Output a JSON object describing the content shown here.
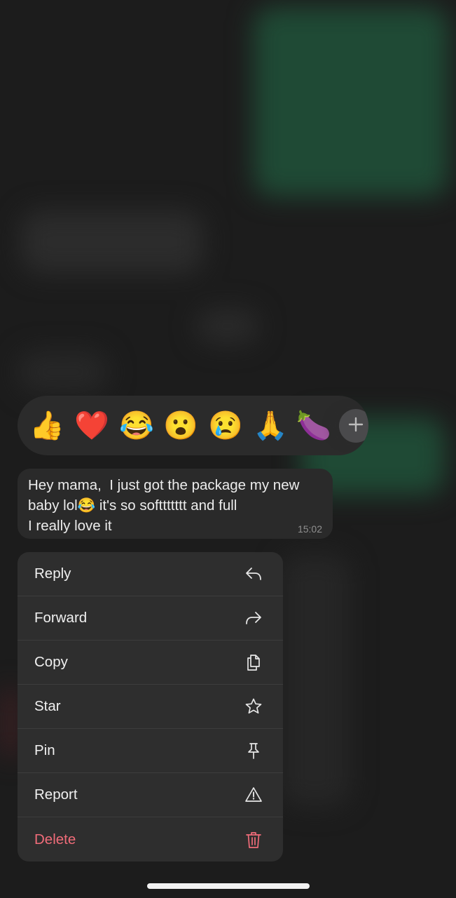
{
  "reactions": {
    "emojis": [
      "👍",
      "❤️",
      "😂",
      "😮",
      "😢",
      "🙏",
      "🍆"
    ],
    "more_icon": "plus-icon"
  },
  "message": {
    "text": "Hey mama,  I just got the package my new\nbaby lol😂 it's so soft​tttttt and full\nI really love it",
    "time": "15:02"
  },
  "menu": {
    "items": [
      {
        "label": "Reply",
        "icon": "reply-icon"
      },
      {
        "label": "Forward",
        "icon": "forward-icon"
      },
      {
        "label": "Copy",
        "icon": "copy-icon"
      },
      {
        "label": "Star",
        "icon": "star-icon"
      },
      {
        "label": "Pin",
        "icon": "pin-icon"
      },
      {
        "label": "Report",
        "icon": "report-icon"
      },
      {
        "label": "Delete",
        "icon": "trash-icon"
      }
    ]
  },
  "colors": {
    "background": "#1c1c1c",
    "surface": "#2e2e2e",
    "destructive": "#f06c79",
    "chat_green": "#1f4a35"
  }
}
